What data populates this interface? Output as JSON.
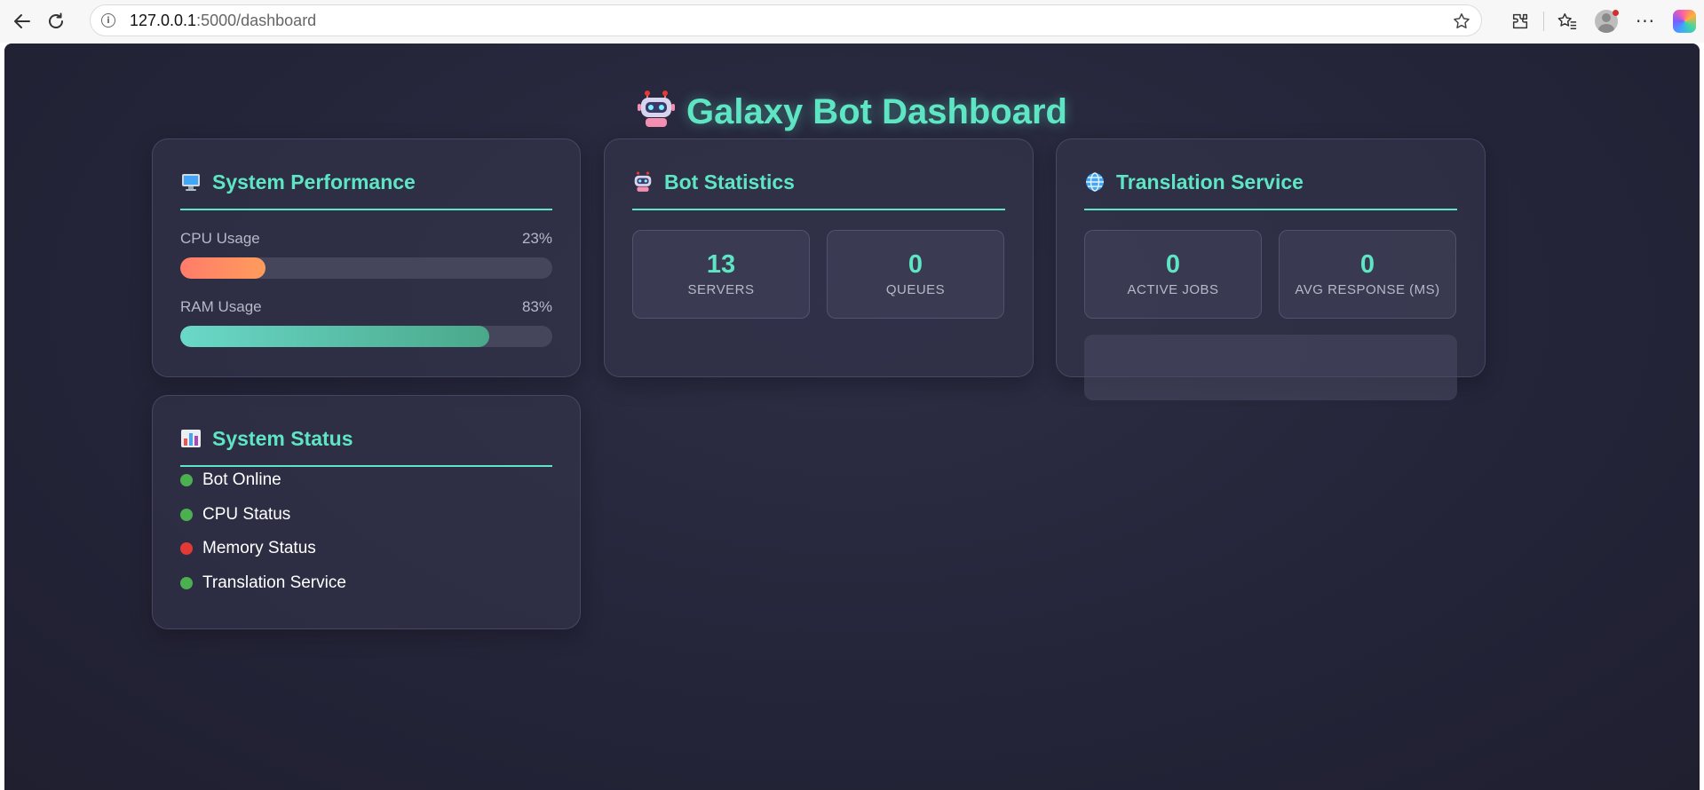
{
  "browser": {
    "url_host": "127.0.0.1",
    "url_path": ":5000/dashboard"
  },
  "page": {
    "title": "Galaxy Bot Dashboard"
  },
  "performance": {
    "title": "System Performance",
    "cpu_label": "CPU Usage",
    "cpu_value": "23%",
    "cpu_percent": 23,
    "ram_label": "RAM Usage",
    "ram_value": "83%",
    "ram_percent": 83
  },
  "bot_stats": {
    "title": "Bot Statistics",
    "stats": [
      {
        "value": "13",
        "label": "SERVERS"
      },
      {
        "value": "0",
        "label": "QUEUES"
      }
    ]
  },
  "translation": {
    "title": "Translation Service",
    "stats": [
      {
        "value": "0",
        "label": "ACTIVE JOBS"
      },
      {
        "value": "0",
        "label": "AVG RESPONSE (MS)"
      }
    ]
  },
  "status": {
    "title": "System Status",
    "items": [
      {
        "label": "Bot Online",
        "color": "#4caf50"
      },
      {
        "label": "CPU Status",
        "color": "#4caf50"
      },
      {
        "label": "Memory Status",
        "color": "#e53935"
      },
      {
        "label": "Translation Service",
        "color": "#4caf50"
      }
    ]
  },
  "colors": {
    "accent": "#5ee6c4",
    "background": "#25253a",
    "cpu_bar": "#ff7c6a",
    "ram_bar": "#4aa88a"
  }
}
